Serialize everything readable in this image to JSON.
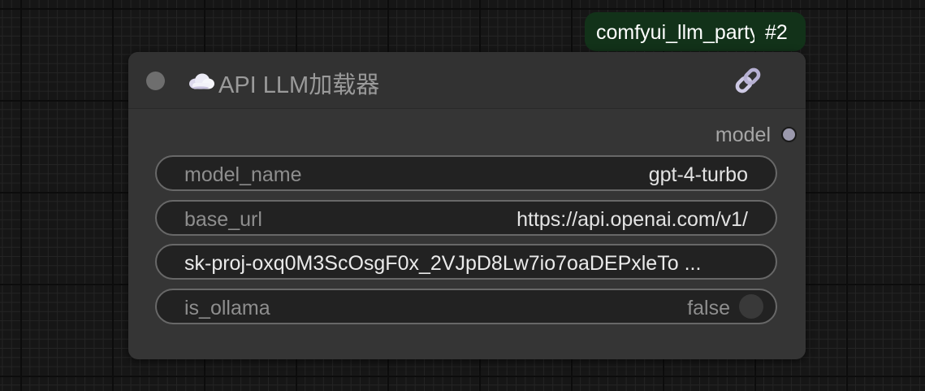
{
  "badge": {
    "text": "comfyui_llm_party",
    "id": "#2"
  },
  "node": {
    "title": "API LLM加载器",
    "icon": "cloud-icon",
    "link_icon": "link-icon",
    "output": {
      "label": "model"
    },
    "widgets": [
      {
        "label": "model_name",
        "value": "gpt-4-turbo"
      },
      {
        "label": "base_url",
        "value": "https://api.openai.com/v1/"
      },
      {
        "value": "sk-proj-oxq0M3ScOsgF0x_2VJpD8Lw7io7oaDEPxleTo ..."
      },
      {
        "label": "is_ollama",
        "value": "false"
      }
    ]
  },
  "colors": {
    "canvas": "#161616",
    "node_body": "#353535",
    "badge_bg": "#123219",
    "widget_bg": "#222222",
    "widget_border": "#686868",
    "socket": "#9b99ad"
  }
}
